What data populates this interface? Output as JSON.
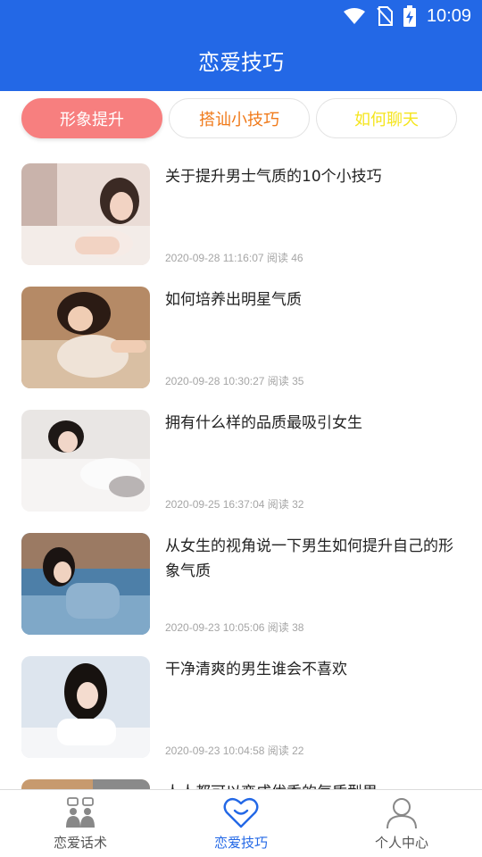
{
  "status_bar": {
    "time": "10:09"
  },
  "header": {
    "title": "恋爱技巧"
  },
  "tabs": [
    {
      "label": "形象提升",
      "active": true,
      "color": "#f77f7f"
    },
    {
      "label": "搭讪小技巧",
      "active": false,
      "color": "#f07a1a"
    },
    {
      "label": "如何聊天",
      "active": false,
      "color": "#f5e51c"
    }
  ],
  "articles": [
    {
      "title": "关于提升男士气质的10个小技巧",
      "meta": "2020-09-28 11:16:07 阅读 46"
    },
    {
      "title": "如何培养出明星气质",
      "meta": "2020-09-28 10:30:27 阅读 35"
    },
    {
      "title": "拥有什么样的品质最吸引女生",
      "meta": "2020-09-25 16:37:04 阅读 32"
    },
    {
      "title": "从女生的视角说一下男生如何提升自己的形象气质",
      "meta": "2020-09-23 10:05:06 阅读 38"
    },
    {
      "title": "干净清爽的男生谁会不喜欢",
      "meta": "2020-09-23 10:04:58 阅读 22"
    },
    {
      "title": "人人都可以变成优秀的气质型男",
      "meta": ""
    }
  ],
  "bottom_nav": [
    {
      "label": "恋爱话术",
      "icon": "people-chat-icon",
      "active": false
    },
    {
      "label": "恋爱技巧",
      "icon": "heart-icon",
      "active": true
    },
    {
      "label": "个人中心",
      "icon": "person-icon",
      "active": false
    }
  ],
  "colors": {
    "primary": "#2368e6",
    "inactive": "#555555",
    "meta": "#a5a5a5"
  }
}
